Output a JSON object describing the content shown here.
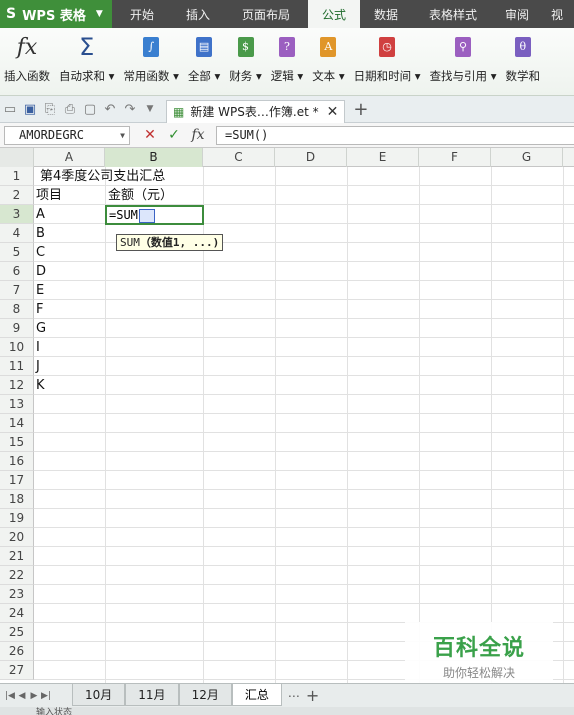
{
  "app": {
    "name": "WPS 表格",
    "logo": "S"
  },
  "menu": [
    "开始",
    "插入",
    "页面布局",
    "公式",
    "数据",
    "表格样式",
    "审阅",
    "视"
  ],
  "menu_active_index": 3,
  "ribbon": [
    {
      "label": "插入函数",
      "icon": "fx-icon"
    },
    {
      "label": "自动求和",
      "icon": "sigma-icon"
    },
    {
      "label": "常用函数",
      "icon": "common-func-icon"
    },
    {
      "label": "全部",
      "icon": "all-func-icon"
    },
    {
      "label": "财务",
      "icon": "finance-icon"
    },
    {
      "label": "逻辑",
      "icon": "logic-icon"
    },
    {
      "label": "文本",
      "icon": "text-icon"
    },
    {
      "label": "日期和时间",
      "icon": "datetime-icon"
    },
    {
      "label": "查找与引用",
      "icon": "lookup-icon"
    },
    {
      "label": "数学和",
      "icon": "math-icon"
    }
  ],
  "document_tab": {
    "title": "新建 WPS表…作簿.et *"
  },
  "formula_bar": {
    "name_box": "AMORDEGRC",
    "formula": "=SUM()"
  },
  "columns": [
    "A",
    "B",
    "C",
    "D",
    "E",
    "F",
    "G"
  ],
  "selected_column": "B",
  "rows": [
    "1",
    "2",
    "3",
    "4",
    "5",
    "6",
    "7",
    "8",
    "9",
    "10",
    "11",
    "12",
    "13",
    "14",
    "15",
    "16",
    "17",
    "18",
    "19",
    "20",
    "21",
    "22",
    "23",
    "24",
    "25",
    "26",
    "27"
  ],
  "selected_row": "3",
  "cells": {
    "title": "第4季度公司支出汇总",
    "header_a": "项目",
    "header_b": "金额（元）",
    "items": [
      "A",
      "B",
      "C",
      "D",
      "E",
      "F",
      "G",
      "I",
      "J",
      "K"
    ]
  },
  "editing_cell": {
    "text": "=SUM"
  },
  "tooltip": {
    "fn": "SUM",
    "args": "（数值1, ...)"
  },
  "sheets": [
    "10月",
    "11月",
    "12月",
    "汇总"
  ],
  "active_sheet": "汇总",
  "watermark": {
    "line1": "百科全说",
    "line2": "助你轻松解决"
  },
  "status": "输入状态"
}
